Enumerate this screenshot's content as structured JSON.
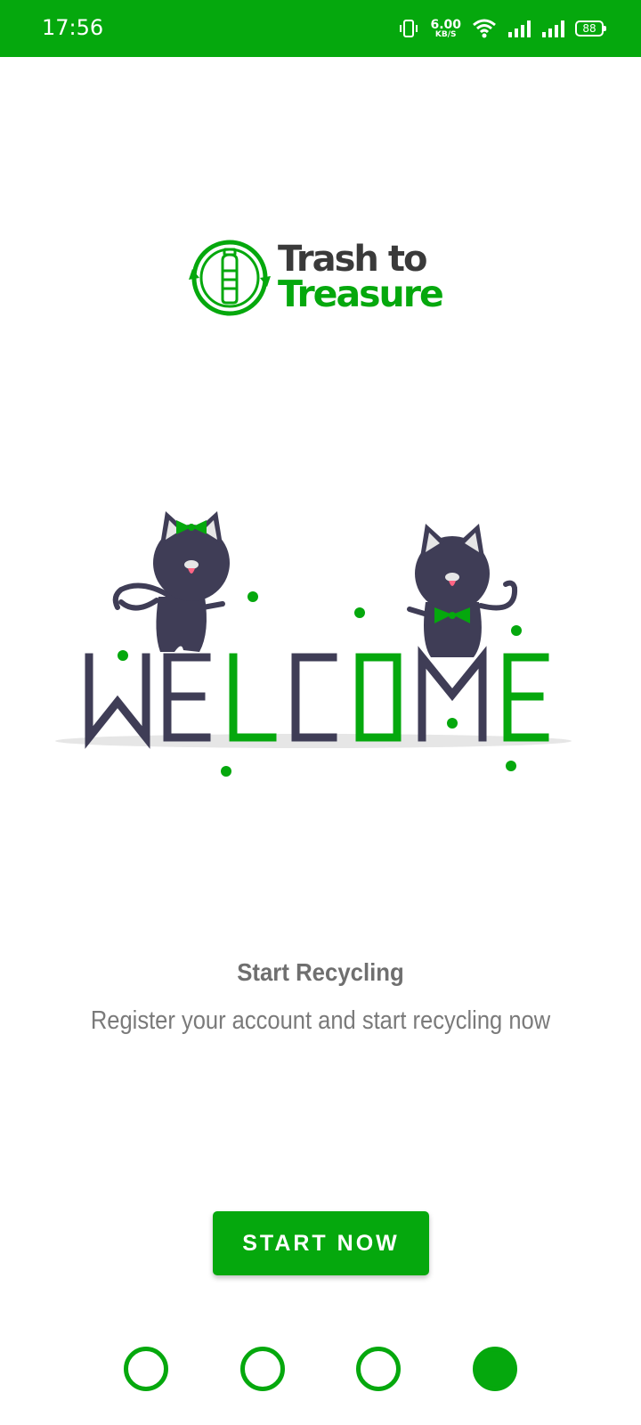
{
  "colors": {
    "brand_green": "#05a80d",
    "dark": "#3a3a3a",
    "cat": "#3f3d56",
    "text_gray": "#6f6f6f"
  },
  "status_bar": {
    "time": "17:56",
    "net_speed_value": "6.00",
    "net_speed_unit": "KB/S",
    "battery": "88",
    "icons": [
      "vibrate-icon",
      "wifi-icon",
      "signal-icon",
      "signal-icon",
      "battery-icon"
    ]
  },
  "logo": {
    "line1": "Trash to",
    "line2": "Treasure",
    "icon": "recycle-bottle-icon"
  },
  "illustration": {
    "word": "WELCOME"
  },
  "onboarding": {
    "title": "Start Recycling",
    "description": "Register your account and start recycling now",
    "button_label": "START NOW"
  },
  "pager": {
    "total": 4,
    "active_index": 3
  }
}
